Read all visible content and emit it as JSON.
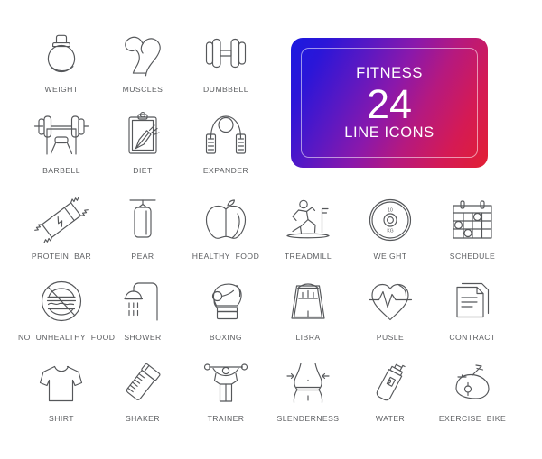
{
  "sheet": {
    "background_color": "#ffffff",
    "stroke_color": "#55575a",
    "caption_color": "#5c5e61"
  },
  "promo_card": {
    "title": "FITNESS",
    "number": "24",
    "subtitle": "LINE ICONS",
    "gradient_start": "#1a1ae0",
    "gradient_mid": "#8a18ab",
    "gradient_end": "#e21f33",
    "text_color": "#ffffff"
  },
  "icons": [
    {
      "id": "weight-kettlebell",
      "label": "WEIGHT",
      "row": 1,
      "col": 1
    },
    {
      "id": "muscles",
      "label": "MUSCLES",
      "row": 1,
      "col": 2
    },
    {
      "id": "dumbbell",
      "label": "DUMBBELL",
      "row": 1,
      "col": 3
    },
    {
      "id": "barbell",
      "label": "BARBELL",
      "row": 2,
      "col": 1
    },
    {
      "id": "diet",
      "label": "DIET",
      "row": 2,
      "col": 2
    },
    {
      "id": "expander",
      "label": "EXPANDER",
      "row": 2,
      "col": 3
    },
    {
      "id": "protein-bar",
      "label": "PROTEIN  BAR",
      "row": 3,
      "col": 1
    },
    {
      "id": "pear",
      "label": "PEAR",
      "row": 3,
      "col": 2
    },
    {
      "id": "healthy-food",
      "label": "HEALTHY  FOOD",
      "row": 3,
      "col": 3
    },
    {
      "id": "treadmill",
      "label": "TREADMILL",
      "row": 3,
      "col": 4
    },
    {
      "id": "weight-plate",
      "label": "WEIGHT",
      "row": 3,
      "col": 5
    },
    {
      "id": "schedule",
      "label": "SCHEDULE",
      "row": 3,
      "col": 6
    },
    {
      "id": "no-unhealthy-food",
      "label": "NO  UNHEALTHY  FOOD",
      "row": 4,
      "col": 1
    },
    {
      "id": "shower",
      "label": "SHOWER",
      "row": 4,
      "col": 2
    },
    {
      "id": "boxing",
      "label": "BOXING",
      "row": 4,
      "col": 3
    },
    {
      "id": "libra",
      "label": "LIBRA",
      "row": 4,
      "col": 4
    },
    {
      "id": "pulse",
      "label": "PUSLE",
      "row": 4,
      "col": 5
    },
    {
      "id": "contract",
      "label": "CONTRACT",
      "row": 4,
      "col": 6
    },
    {
      "id": "shirt",
      "label": "SHIRT",
      "row": 5,
      "col": 1
    },
    {
      "id": "shaker",
      "label": "SHAKER",
      "row": 5,
      "col": 2
    },
    {
      "id": "trainer",
      "label": "TRAINER",
      "row": 5,
      "col": 3
    },
    {
      "id": "slenderness",
      "label": "SLENDERNESS",
      "row": 5,
      "col": 4
    },
    {
      "id": "water",
      "label": "WATER",
      "row": 5,
      "col": 5
    },
    {
      "id": "exercise-bike",
      "label": "EXERCISE  BIKE",
      "row": 5,
      "col": 6
    }
  ],
  "plate_markings": {
    "top": "10",
    "bottom": "KG"
  }
}
